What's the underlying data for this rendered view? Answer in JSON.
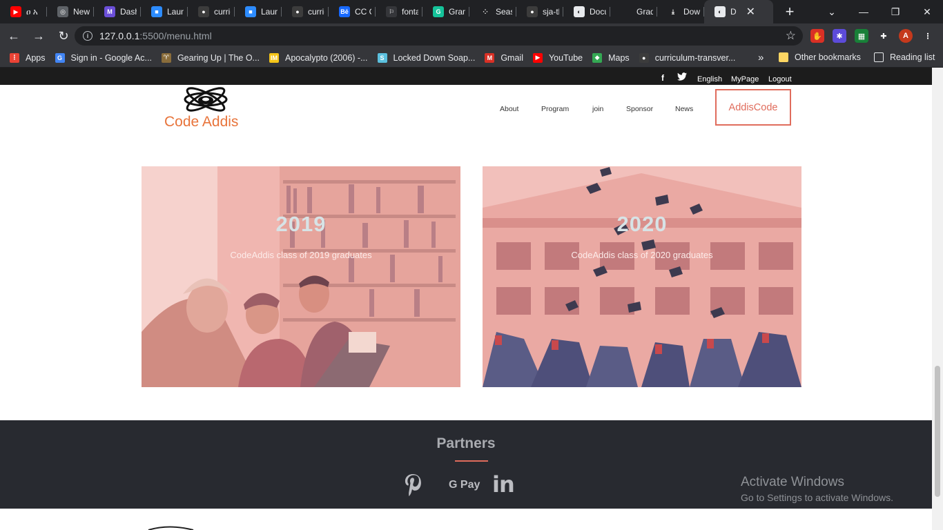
{
  "browser": {
    "tabs": [
      {
        "label": "ዐ አ",
        "color": "#ff0000",
        "glyph": "▶"
      },
      {
        "label": "New",
        "color": "#5f6368",
        "glyph": "◎"
      },
      {
        "label": "Dash",
        "color": "#6b4fd8",
        "glyph": "M"
      },
      {
        "label": "Laun",
        "color": "#2d8cff",
        "glyph": "■"
      },
      {
        "label": "curric",
        "color": "#3c3c3c",
        "glyph": "●"
      },
      {
        "label": "Laun",
        "color": "#2d8cff",
        "glyph": "■"
      },
      {
        "label": "curric",
        "color": "#3c3c3c",
        "glyph": "●"
      },
      {
        "label": "CC G",
        "color": "#1769ff",
        "glyph": "Bē"
      },
      {
        "label": "fonta",
        "color": "#35363a",
        "glyph": "⚐"
      },
      {
        "label": "Gram",
        "color": "#15c39a",
        "glyph": "G"
      },
      {
        "label": "Seas",
        "color": "#202124",
        "glyph": "⁘"
      },
      {
        "label": "sja-th",
        "color": "#3c3c3c",
        "glyph": "●"
      },
      {
        "label": "Docu",
        "color": "#e8eaed",
        "glyph": "◐"
      },
      {
        "label": "Grad",
        "color": "#202124",
        "glyph": ""
      },
      {
        "label": "Down",
        "color": "#202124",
        "glyph": "⤓"
      },
      {
        "label": "D",
        "color": "#e8eaed",
        "glyph": "◐",
        "active": true
      }
    ],
    "new_tab_symbol": "+",
    "window_controls": {
      "minimize": "⌄",
      "restore": "—",
      "maximize": "❐",
      "close": "✕"
    },
    "url_host": "127.0.0.1",
    "url_path": ":5500/menu.html",
    "extensions": [
      {
        "name": "adblock-icon",
        "color": "#d93025",
        "glyph": "✋"
      },
      {
        "name": "extension-purple-icon",
        "color": "#5c4bd9",
        "glyph": "✱"
      },
      {
        "name": "extension-badge-icon",
        "color": "#188038",
        "glyph": "▦"
      },
      {
        "name": "puzzle-icon",
        "color": "#35363a",
        "glyph": "✚"
      },
      {
        "name": "profile-avatar",
        "color": "#c5391c",
        "glyph": "A"
      },
      {
        "name": "menu-icon",
        "color": "#35363a",
        "glyph": "⋮"
      }
    ],
    "bookmarks": [
      {
        "label": "Apps",
        "color": "#ea4335",
        "glyph": "⋮"
      },
      {
        "label": "Sign in - Google Ac...",
        "color": "#4285f4",
        "glyph": "G"
      },
      {
        "label": "Gearing Up | The O...",
        "color": "#8a6d3b",
        "glyph": "♈"
      },
      {
        "label": "Apocalypto (2006) -...",
        "color": "#f5c518",
        "glyph": "IM"
      },
      {
        "label": "Locked Down Soap...",
        "color": "#5bc0de",
        "glyph": "S"
      },
      {
        "label": "Gmail",
        "color": "#d93025",
        "glyph": "M"
      },
      {
        "label": "YouTube",
        "color": "#ff0000",
        "glyph": "▶"
      },
      {
        "label": "Maps",
        "color": "#34a853",
        "glyph": "◆"
      },
      {
        "label": "curriculum-transver...",
        "color": "#3c3c3c",
        "glyph": "●"
      }
    ],
    "bookmarks_overflow": "»",
    "other_bookmarks": "Other bookmarks",
    "reading_list": "Reading list"
  },
  "site": {
    "top_links": [
      "English",
      "MyPage",
      "Logout"
    ],
    "social": [
      "f",
      "🐦"
    ],
    "logo_text": "Code Addis",
    "nav": [
      "About",
      "Program",
      "join",
      "Sponsor",
      "News"
    ],
    "cta": "AddisCode",
    "cards": [
      {
        "year": "2019",
        "caption": "CodeAddis class of 2019 graduates"
      },
      {
        "year": "2020",
        "caption": "CodeAddis class of 2020 graduates"
      }
    ],
    "partners_title": "Partners",
    "partners": [
      "pinterest-icon",
      "gpay-icon",
      "linkedin-icon"
    ],
    "gpay_label": "G Pay",
    "linkedin_label": "in"
  },
  "watermark": {
    "line1": "Activate Windows",
    "line2": "Go to Settings to activate Windows."
  }
}
